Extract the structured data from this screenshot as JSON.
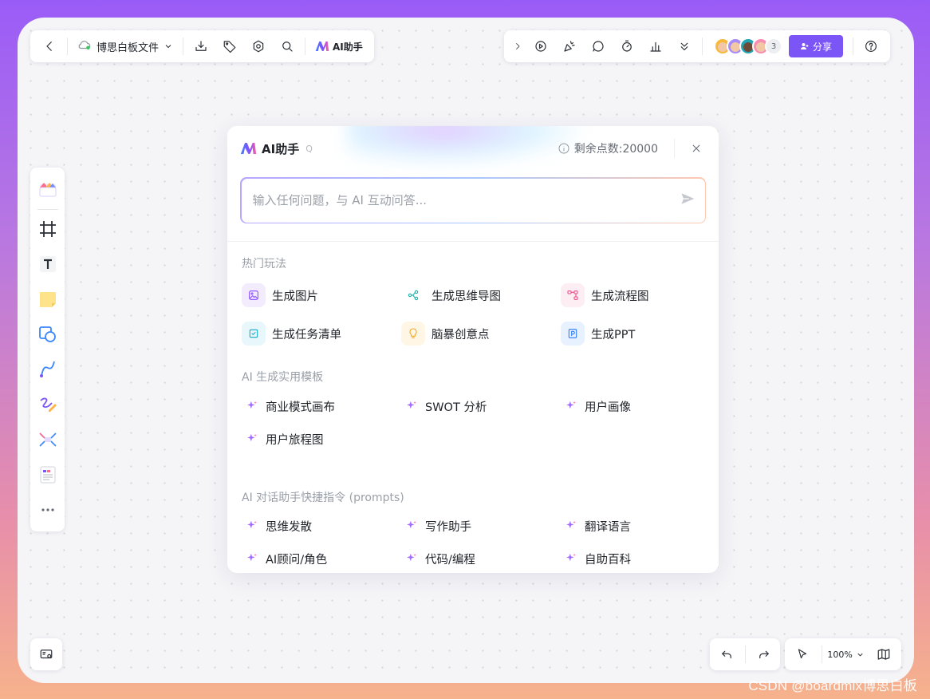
{
  "topbar_left": {
    "doc_title": "博思白板文件",
    "ai_entry_label": "AI助手"
  },
  "topbar_right": {
    "avatar_count": "3",
    "share_label": "分享"
  },
  "dialog": {
    "title": "AI助手",
    "shortcut": "Q",
    "points_label": "剩余点数:20000",
    "input_placeholder": "输入任何问题，与 AI 互动问答...",
    "sections": {
      "hot": {
        "label": "热门玩法",
        "items": [
          "生成图片",
          "生成思维导图",
          "生成流程图",
          "生成任务清单",
          "脑暴创意点",
          "生成PPT"
        ]
      },
      "templates": {
        "label": "AI 生成实用模板",
        "items": [
          "商业模式画布",
          "SWOT 分析",
          "用户画像",
          "用户旅程图"
        ]
      },
      "prompts": {
        "label": "AI 对话助手快捷指令 (prompts)",
        "items": [
          "思维发散",
          "写作助手",
          "翻译语言",
          "AI顾问/角色",
          "代码/编程",
          "自助百科"
        ]
      }
    }
  },
  "bottom": {
    "zoom": "100%"
  },
  "watermark": "CSDN @boardmix博思白板",
  "colors": {
    "accent": "#7b55f5",
    "frame_top": "#9a5cf7",
    "frame_bottom": "#f6b28c"
  }
}
